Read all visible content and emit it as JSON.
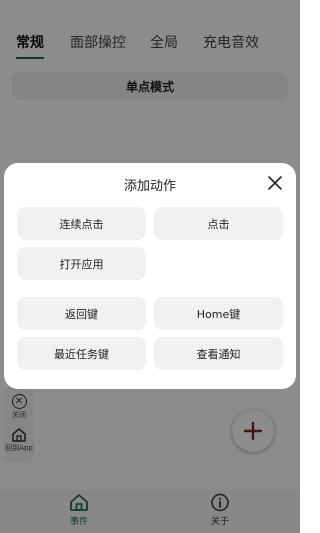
{
  "tabs": [
    {
      "label": "常规",
      "active": true
    },
    {
      "label": "面部操控",
      "active": false
    },
    {
      "label": "全局",
      "active": false
    },
    {
      "label": "充电音效",
      "active": false
    }
  ],
  "mode_bar": {
    "label": "单点模式"
  },
  "side_buttons": {
    "close_label": "关闭",
    "home_label": "回到App"
  },
  "fab": {
    "icon": "plus-icon"
  },
  "bottom_nav": [
    {
      "label": "事件",
      "icon": "home-icon",
      "active": true
    },
    {
      "label": "关于",
      "icon": "info-icon",
      "active": false
    }
  ],
  "dialog": {
    "title": "添加动作",
    "actions": [
      "连续点击",
      "点击",
      "打开应用",
      "返回键",
      "Home键",
      "最近任务键",
      "查看通知"
    ]
  },
  "colors": {
    "accent": "#1f6f4a",
    "fab_plus": "#7a2a1e"
  }
}
